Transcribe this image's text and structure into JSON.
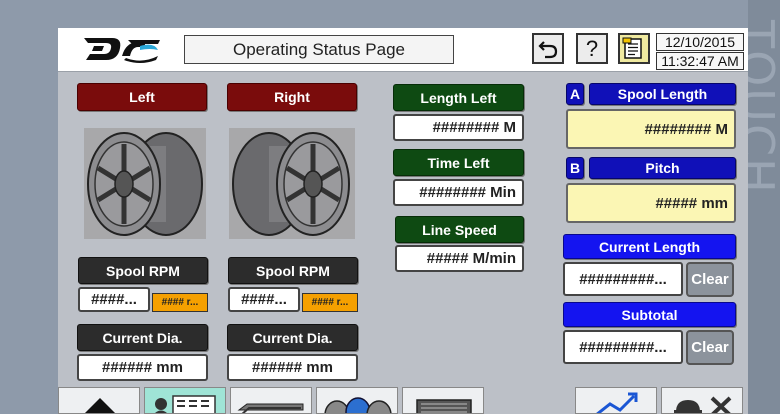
{
  "header": {
    "title": "Operating Status Page",
    "undo_icon": "undo-icon",
    "help_label": "?",
    "notes_icon": "notes-icon",
    "date": "12/10/2015",
    "time": "11:32:47 AM"
  },
  "bezel": {
    "text": "TOUCH"
  },
  "left": {
    "title": "Left",
    "spool_rpm_label": "Spool RPM",
    "spool_rpm_value": "####...",
    "spool_rpm_badge": "#### r...",
    "current_dia_label": "Current Dia.",
    "current_dia_value": "###### mm"
  },
  "right": {
    "title": "Right",
    "spool_rpm_label": "Spool RPM",
    "spool_rpm_value": "####...",
    "spool_rpm_badge": "#### r...",
    "current_dia_label": "Current Dia.",
    "current_dia_value": "###### mm"
  },
  "center": {
    "length_left_label": "Length Left",
    "length_left_value": "######## M",
    "time_left_label": "Time Left",
    "time_left_value": "######## Min",
    "line_speed_label": "Line Speed",
    "line_speed_value": "##### M/min"
  },
  "settings": {
    "a_tag": "A",
    "spool_length_label": "Spool Length",
    "spool_length_value": "######## M",
    "b_tag": "B",
    "pitch_label": "Pitch",
    "pitch_value": "##### mm",
    "current_length_label": "Current Length",
    "current_length_value": "#########...",
    "clear1": "Clear",
    "subtotal_label": "Subtotal",
    "subtotal_value": "#########...",
    "clear2": "Clear"
  },
  "colors": {
    "title_red": "#7a0c0c",
    "title_green": "#0e4a12",
    "label_dark": "#2c2c2c",
    "label_blue": "#1010b8",
    "value_yellow": "#fbf6b4",
    "badge_orange": "#f5a000"
  },
  "nav": {
    "icons": [
      "home-icon",
      "operator-panel-icon",
      "machine-icon",
      "spools-icon",
      "motor-icon",
      "trend-icon",
      "maintenance-icon"
    ]
  }
}
